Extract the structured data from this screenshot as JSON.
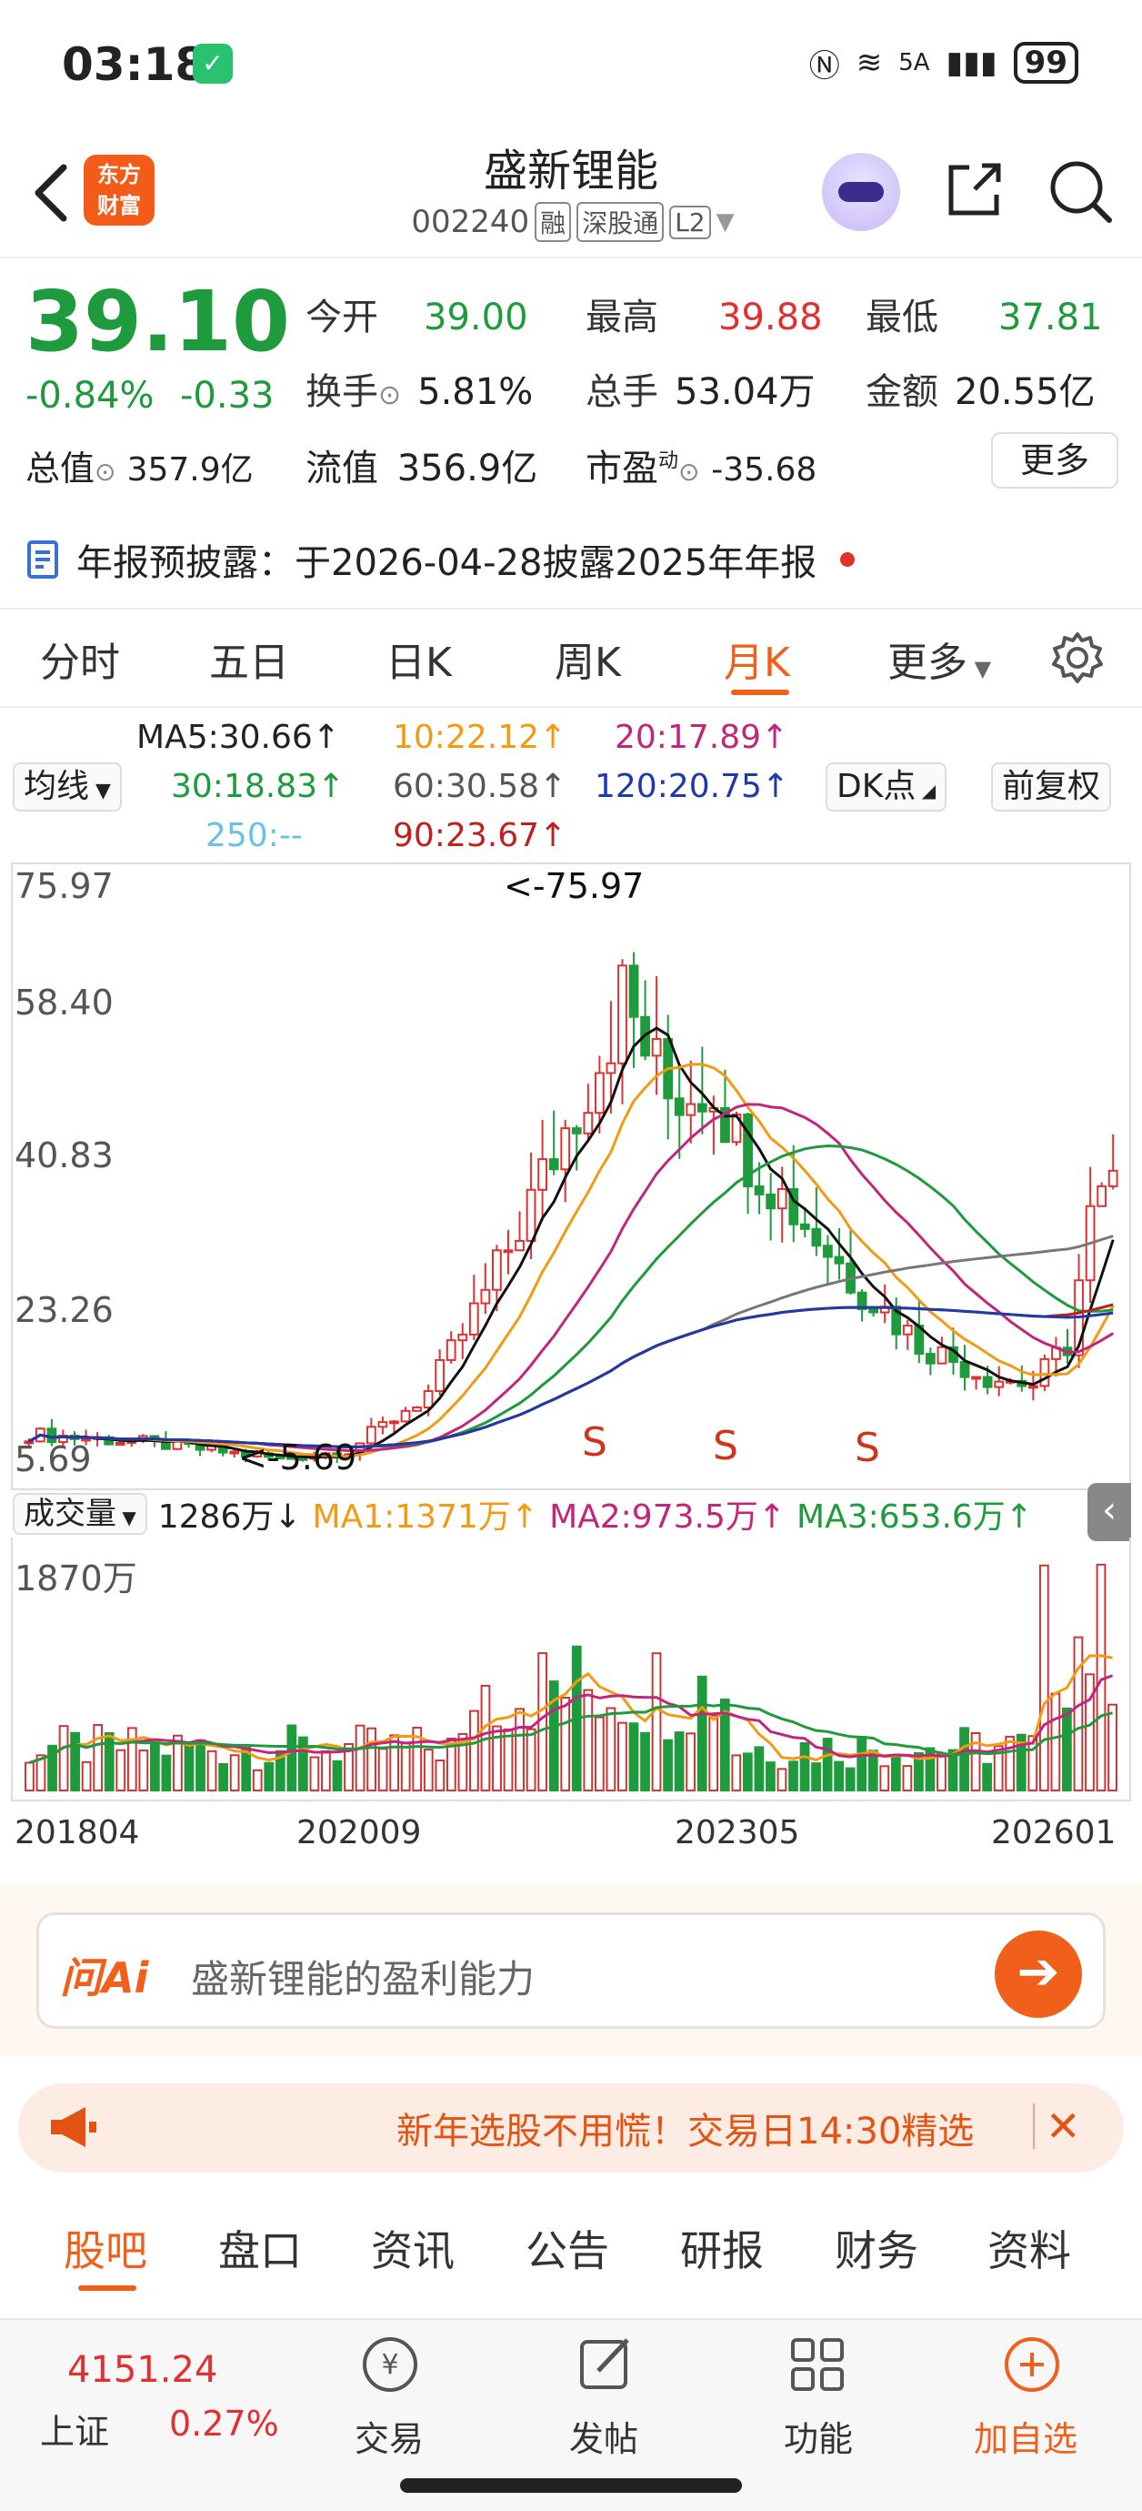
{
  "status": {
    "time": "03:18",
    "battery": "99",
    "network": "5A"
  },
  "header": {
    "logo_line1": "东方",
    "logo_line2": "财富",
    "title": "盛新锂能",
    "code": "002240",
    "tags": [
      "融",
      "深股通",
      "L2"
    ]
  },
  "quote": {
    "price": "39.10",
    "pct": "-0.84%",
    "chg": "-0.33",
    "rows": [
      [
        {
          "label": "今开",
          "value": "39.00",
          "color": "green"
        },
        {
          "label": "最高",
          "value": "39.88",
          "color": "red"
        },
        {
          "label": "最低",
          "value": "37.81",
          "color": "green"
        }
      ],
      [
        {
          "label": "换手",
          "value": "5.81%",
          "color": "dark"
        },
        {
          "label": "总手",
          "value": "53.04万",
          "color": "dark"
        },
        {
          "label": "金额",
          "value": "20.55亿",
          "color": "dark"
        }
      ]
    ],
    "mcap_label": "总值",
    "mcap": "357.9亿",
    "float_label": "流值",
    "float_cap": "356.9亿",
    "pe_label": "市盈",
    "pe_sup": "动",
    "pe": "-35.68",
    "more": "更多"
  },
  "notice": "年报预披露：于2026-04-28披露2025年年报",
  "ktabs": [
    "分时",
    "五日",
    "日K",
    "周K",
    "月K",
    "更多"
  ],
  "ktab_active": "月K",
  "ma_legend": {
    "type_select": "均线",
    "ma5": "MA5:30.66↑",
    "ma10": "10:22.12↑",
    "ma20": "20:17.89↑",
    "ma30": "30:18.83↑",
    "ma60": "60:30.58↑",
    "ma120": "120:20.75↑",
    "ma250": "250:--",
    "ma90": "90:23.67↑",
    "dk": "DK点",
    "fq": "前复权"
  },
  "chart": {
    "y_labels": [
      "75.97",
      "58.40",
      "40.83",
      "23.26",
      "5.69"
    ],
    "max_label": "<-75.97",
    "min_label": "<-5.69",
    "s_markers": [
      "S",
      "S",
      "S"
    ]
  },
  "volume": {
    "select": "成交量",
    "current": "1286万↓",
    "ma1": "MA1:1371万↑",
    "ma2": "MA2:973.5万↑",
    "ma3": "MA3:653.6万↑",
    "y_label": "1870万",
    "x_labels": [
      "201804",
      "202009",
      "202305",
      "202601"
    ]
  },
  "colors": {
    "accent": "#f0601b",
    "up": "#e23030",
    "down": "#1e9b3c"
  },
  "ai": {
    "logo": "问Ai",
    "prompt": "盛新锂能的盈利能力"
  },
  "banner": "新年选股不用慌！交易日14:30精选",
  "btabs": [
    "股吧",
    "盘口",
    "资讯",
    "公告",
    "研报",
    "财务",
    "资料"
  ],
  "bottom": {
    "index_value": "4151.24",
    "index_name": "上证",
    "index_pct": "0.27%",
    "items": [
      "交易",
      "发帖",
      "功能",
      "加自选"
    ]
  }
}
